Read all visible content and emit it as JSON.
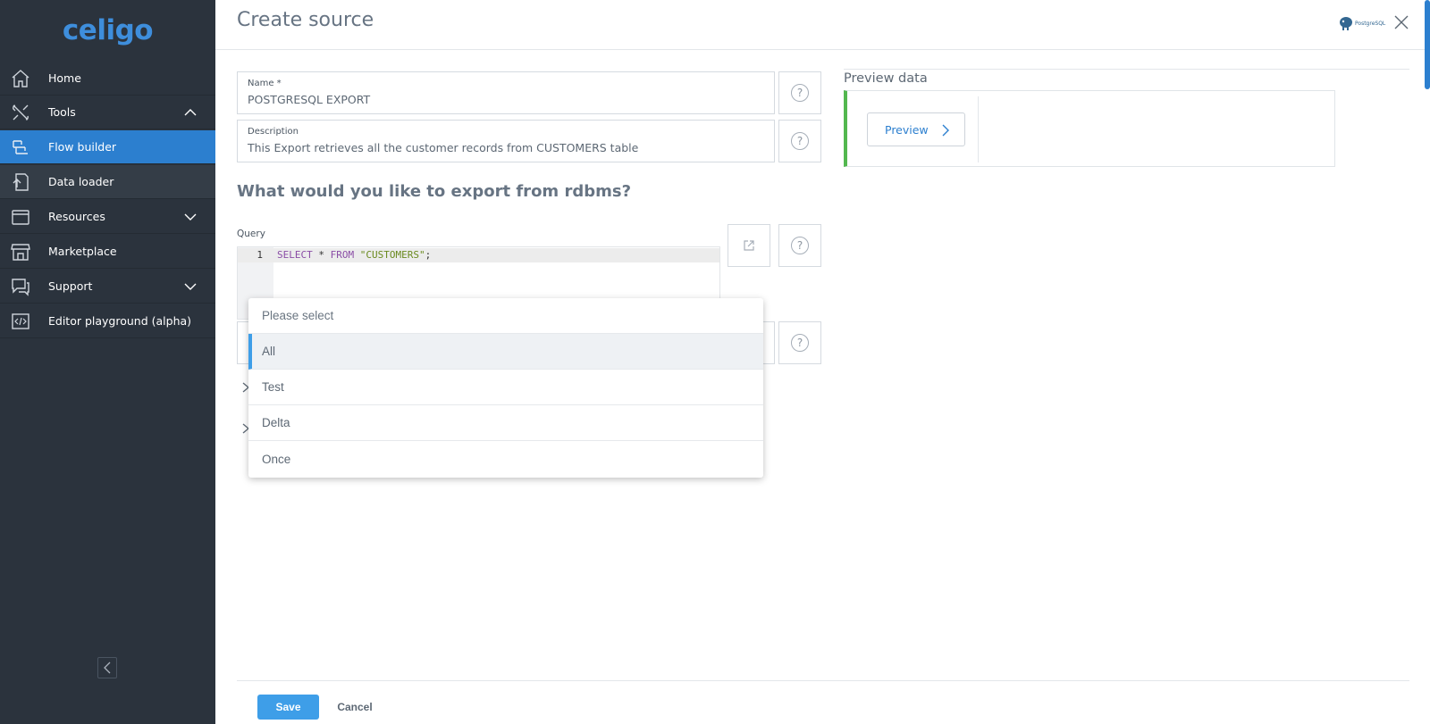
{
  "brand": {
    "logo_text": "celigo"
  },
  "sidebar": {
    "items": [
      {
        "label": "Home",
        "icon": "home-icon"
      },
      {
        "label": "Tools",
        "icon": "tools-icon",
        "expanded": true
      },
      {
        "label": "Flow builder",
        "icon": "flow-builder-icon",
        "active": true
      },
      {
        "label": "Data loader",
        "icon": "data-loader-icon"
      },
      {
        "label": "Resources",
        "icon": "resources-icon",
        "expanded": false
      },
      {
        "label": "Marketplace",
        "icon": "marketplace-icon"
      },
      {
        "label": "Support",
        "icon": "support-icon",
        "expanded": false
      },
      {
        "label": "Editor playground (alpha)",
        "icon": "code-icon"
      }
    ]
  },
  "header": {
    "title": "Create source",
    "app_logo_text": "PostgreSQL"
  },
  "form": {
    "name": {
      "label": "Name *",
      "value": "POSTGRESQL EXPORT"
    },
    "description": {
      "label": "Description",
      "value": "This Export retrieves all the customer records from CUSTOMERS table"
    },
    "section_heading": "What would you like to export from rdbms?",
    "query": {
      "label": "Query",
      "line_number": "1",
      "code_keyword1": "SELECT",
      "code_mid": " * ",
      "code_keyword2": "FROM",
      "code_string": "\"CUSTOMERS\"",
      "code_end": ";"
    }
  },
  "dropdown": {
    "options": [
      "Please select",
      "All",
      "Test",
      "Delta",
      "Once"
    ],
    "selected": "All"
  },
  "preview": {
    "title": "Preview data",
    "button_label": "Preview"
  },
  "footer": {
    "save_label": "Save",
    "cancel_label": "Cancel"
  },
  "colors": {
    "sidebar_bg": "#2b333d",
    "active_nav": "#2c7fcf",
    "accent": "#3e9ee8",
    "preview_border": "#53b74f"
  }
}
